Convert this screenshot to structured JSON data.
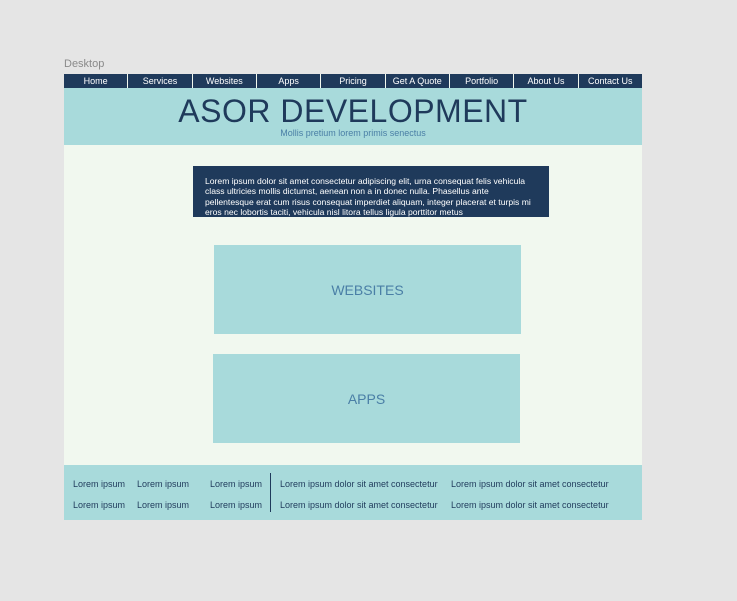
{
  "frame": {
    "label": "Desktop"
  },
  "nav": {
    "items": [
      {
        "label": "Home"
      },
      {
        "label": "Services"
      },
      {
        "label": "Websites"
      },
      {
        "label": "Apps"
      },
      {
        "label": "Pricing"
      },
      {
        "label": "Get A Quote"
      },
      {
        "label": "Portfolio"
      },
      {
        "label": "About Us"
      },
      {
        "label": "Contact Us"
      }
    ]
  },
  "hero": {
    "title": "ASOR DEVELOPMENT",
    "subtitle": "Mollis pretium lorem primis senectus"
  },
  "intro": {
    "text": "Lorem ipsum dolor sit amet consectetur adipiscing elit, urna consequat felis vehicula class ultricies mollis dictumst, aenean non a in donec nulla. Phasellus ante pellentesque erat cum risus consequat imperdiet aliquam, integer placerat et turpis mi eros nec lobortis taciti, vehicula nisl litora tellus ligula porttitor metus"
  },
  "cards": {
    "websites": "WEBSITES",
    "apps": "APPS"
  },
  "footer": {
    "short_links": [
      [
        "Lorem ipsum",
        "Lorem ipsum",
        "Lorem ipsum"
      ],
      [
        "Lorem ipsum",
        "Lorem ipsum",
        "Lorem ipsum"
      ]
    ],
    "long_links": [
      [
        "Lorem ipsum dolor sit amet consectetur",
        "Lorem ipsum dolor sit amet consectetur"
      ],
      [
        "Lorem ipsum dolor sit amet consectetur",
        "Lorem ipsum dolor sit amet consectetur"
      ]
    ]
  },
  "colors": {
    "navy": "#1f3a5b",
    "teal": "#a8dadb",
    "mint_background": "#f1f8ef",
    "accent_blue": "#4a7fa6",
    "canvas_grey": "#e5e5e5"
  }
}
